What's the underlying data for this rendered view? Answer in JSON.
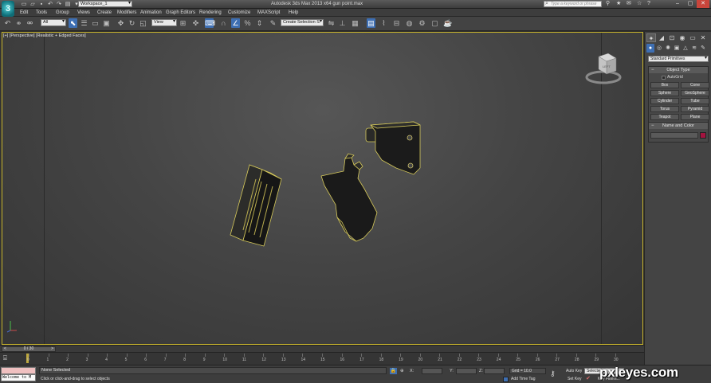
{
  "title_bar": {
    "workspace": "Workspace_1",
    "window_title": "Autodesk 3ds Max 2013 x64     gun point.max",
    "search_placeholder": "Type a keyword or phrase",
    "app_logo_letter": "3"
  },
  "menu": {
    "items": [
      "Edit",
      "Tools",
      "Group",
      "Views",
      "Create",
      "Modifiers",
      "Animation",
      "Graph Editors",
      "Rendering",
      "Customize",
      "MAXScript",
      "Help"
    ]
  },
  "toolbar": {
    "selection_filter": "All",
    "reference_coord": "View",
    "named_selection_placeholder": "Create Selection S"
  },
  "viewport": {
    "label": "[+] [Perspective] [Realistic + Edged Faces]",
    "viewcube_face": "LEFT",
    "border_color": "#c9b52c"
  },
  "command_panel": {
    "category": "Standard Primitives",
    "object_type_title": "Object Type",
    "autogrid_label": "AutoGrid",
    "objects": [
      "Box",
      "Cone",
      "Sphere",
      "GeoSphere",
      "Cylinder",
      "Tube",
      "Torus",
      "Pyramid",
      "Teapot",
      "Plane"
    ],
    "name_color_title": "Name and Color",
    "swatch_color": "#a3133f"
  },
  "timeline": {
    "thumb_label": "0 / 30",
    "ticks": [
      "0",
      "1",
      "2",
      "3",
      "4",
      "5",
      "6",
      "7",
      "8",
      "9",
      "10",
      "11",
      "12",
      "13",
      "14",
      "15",
      "16",
      "17",
      "18",
      "19",
      "20",
      "21",
      "22",
      "23",
      "24",
      "25",
      "26",
      "27",
      "28",
      "29",
      "30"
    ]
  },
  "status": {
    "maxscript_text": "Welcome to M",
    "selection": "None Selected",
    "prompt": "Click or click-and-drag to select objects",
    "x_label": "X:",
    "y_label": "Y:",
    "z_label": "Z:",
    "grid": "Grid = 10.0",
    "add_time_tag": "Add Time Tag",
    "auto_key": "Auto Key",
    "set_key": "Set Key",
    "selected_mode": "Selected",
    "key_filters": "Key Filters..."
  },
  "watermark": "pxleyes.com"
}
